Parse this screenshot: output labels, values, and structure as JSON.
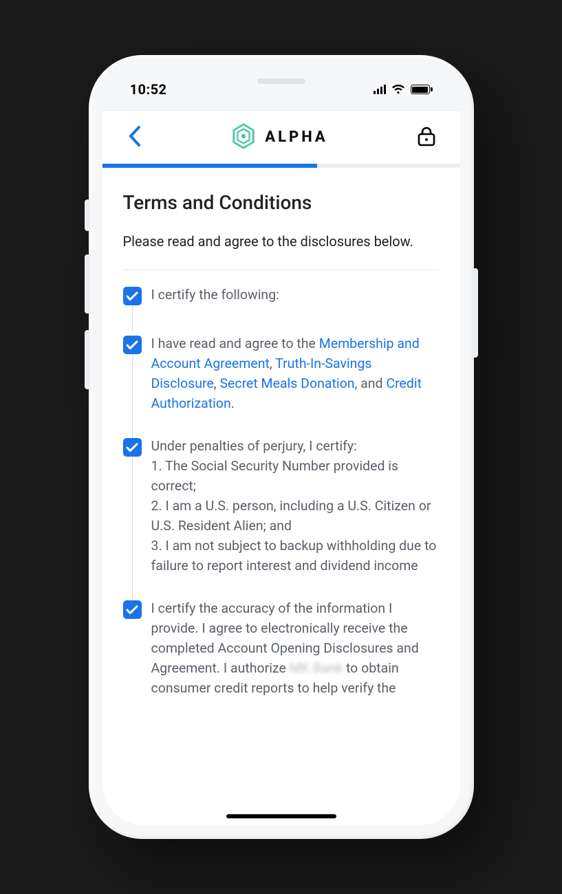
{
  "status": {
    "time": "10:52"
  },
  "header": {
    "brand": "ALPHA"
  },
  "progress": {
    "percent": 60
  },
  "page": {
    "title": "Terms and Conditions",
    "subtitle": "Please read and agree to the disclosures below."
  },
  "checklist": {
    "item1": {
      "text": "I certify the following:"
    },
    "item2": {
      "prefix": "I have read and agree to the ",
      "link1": "Membership and Account Agreement",
      "sep1": ", ",
      "link2": "Truth-In-Savings Disclosure",
      "sep2": ", ",
      "link3": "Secret Meals Donation",
      "sep3": ", and ",
      "link4": "Credit Authorization",
      "suffix": "."
    },
    "item3": {
      "intro": "Under penalties of perjury, I certify:",
      "l1": "1. The Social Security Number provided is correct;",
      "l2": "2. I am a U.S. person, including a U.S. Citizen or U.S. Resident Alien; and",
      "l3": "3. I am not subject to backup withholding due to failure to report interest and dividend income"
    },
    "item4": {
      "p1": "I certify the accuracy of the information I provide. I agree to electronically receive the completed Account Opening Disclosures and Agreement. I authorize ",
      "blur": "MK Bank",
      "p2": " to obtain consumer credit reports to help verify the"
    }
  }
}
